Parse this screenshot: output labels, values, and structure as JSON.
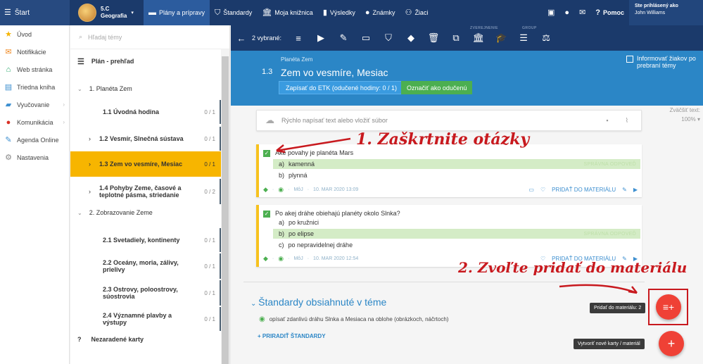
{
  "topbar": {
    "menu_label": "Štart",
    "class_code": "5.C",
    "class_subject": "Geografia",
    "nav": [
      {
        "label": "Plány a prípravy",
        "icon": "book-icon"
      },
      {
        "label": "Štandardy",
        "icon": "shield-icon"
      },
      {
        "label": "Moja knižnica",
        "icon": "library-icon"
      },
      {
        "label": "Výsledky",
        "icon": "bar-chart-icon"
      },
      {
        "label": "Známky",
        "icon": "grade-icon"
      },
      {
        "label": "Žiaci",
        "icon": "students-icon"
      }
    ],
    "help_label": "Pomoc",
    "user_status": "Ste prihlásený ako",
    "user_name": "John Williams"
  },
  "sidebar": {
    "items": [
      {
        "label": "Úvod",
        "icon": "star-icon",
        "color": "#f5b400"
      },
      {
        "label": "Notifikácie",
        "icon": "mail-icon",
        "color": "#f08a24"
      },
      {
        "label": "Web stránka",
        "icon": "home-icon",
        "color": "#1aa260"
      },
      {
        "label": "Triedna kniha",
        "icon": "book-icon",
        "color": "#3d8fd0"
      },
      {
        "label": "Vyučovanie",
        "icon": "briefcase-icon",
        "color": "#3d8fd0"
      },
      {
        "label": "Komunikácia",
        "icon": "chat-icon",
        "color": "#d93025"
      },
      {
        "label": "Agenda Online",
        "icon": "pen-icon",
        "color": "#3d8fd0"
      },
      {
        "label": "Nastavenia",
        "icon": "gear-icon",
        "color": "#888888"
      }
    ]
  },
  "topics": {
    "search_placeholder": "Hľadaj témy",
    "plan_label": "Plán - prehľad",
    "chapter1": "1. Planéta Zem",
    "chapter2": "2. Zobrazovanie Zeme",
    "lessons1": [
      {
        "title": "1.1 Úvodná hodina",
        "count": "0 / 1"
      },
      {
        "title": "1.2 Vesmír, Slnečná sústava",
        "count": "0 / 1"
      },
      {
        "title": "1.3 Zem vo vesmíre, Mesiac",
        "count": "0 / 1"
      },
      {
        "title": "1.4 Pohyby Zeme, časové a teplotné pásma, striedanie",
        "count": "0 / 2"
      }
    ],
    "lessons2": [
      {
        "title": "2.1 Svetadiely, kontinenty",
        "count": "0 / 1"
      },
      {
        "title": "2.2 Oceány, moria, zálivy, prielivy",
        "count": "0 / 1"
      },
      {
        "title": "2.3 Ostrovy, poloostrovy, súostrovia",
        "count": "0 / 1"
      },
      {
        "title": "2.4 Významné plavby a výstupy",
        "count": "0 / 1"
      }
    ],
    "unsorted": "Nezaradené karty"
  },
  "actionbar": {
    "selected_label": "2 vybrané:",
    "group_public": "ZVEREJNENIE",
    "group_group": "GROUP"
  },
  "header": {
    "subtitle": "Planéta Zem",
    "number": "1.3",
    "title": "Zem vo vesmíre, Mesiac",
    "etk_button": "Zapísať do ETK (odučené hodiny: 0 / 1)",
    "done_button": "Označiť ako odučenú",
    "inform_label": "Informovať žiakov po prebraní témy"
  },
  "content": {
    "quick_placeholder": "Rýchlo napísať text alebo vložiť súbor",
    "zoom_label": "Zväčšiť text:",
    "zoom_value": "100%",
    "cards": [
      {
        "question": "Aké povahy je planéta Mars",
        "options": [
          {
            "letter": "a)",
            "text": "kamenná",
            "correct": true
          },
          {
            "letter": "b)",
            "text": "plynná",
            "correct": false
          }
        ],
        "author": "MôJ",
        "date": "10. MAR 2020 13:09"
      },
      {
        "question": "Po akej dráhe obiehajú planéty okolo Slnka?",
        "options": [
          {
            "letter": "a)",
            "text": "po kružnici",
            "correct": false
          },
          {
            "letter": "b)",
            "text": "po elipse",
            "correct": true
          },
          {
            "letter": "c)",
            "text": "po nepravidelnej dráhe",
            "correct": false
          }
        ],
        "author": "MôJ",
        "date": "10. MAR 2020 12:54"
      }
    ],
    "correct_label": "SPRÁVNA ODPOVEĎ",
    "add_material": "PRIDAŤ DO MATERIÁLU",
    "standards_title": "Štandardy obsiahnuté v téme",
    "standard_item": "opísať zdanlivú dráhu Slnka a Mesiaca na oblohe (obrázkoch, náčrtoch)",
    "assign_standards": "+ PRIRADIŤ ŠTANDARDY"
  },
  "fab": {
    "add_tooltip": "Pridať do materiálu: 2",
    "new_tooltip": "Vytvoriť nové karty / materiál"
  },
  "annotations": {
    "step1": "1. Zaškrtnite otázky",
    "step2": "2. Zvoľte pridať do materiálu",
    "color": "#c8191e"
  }
}
